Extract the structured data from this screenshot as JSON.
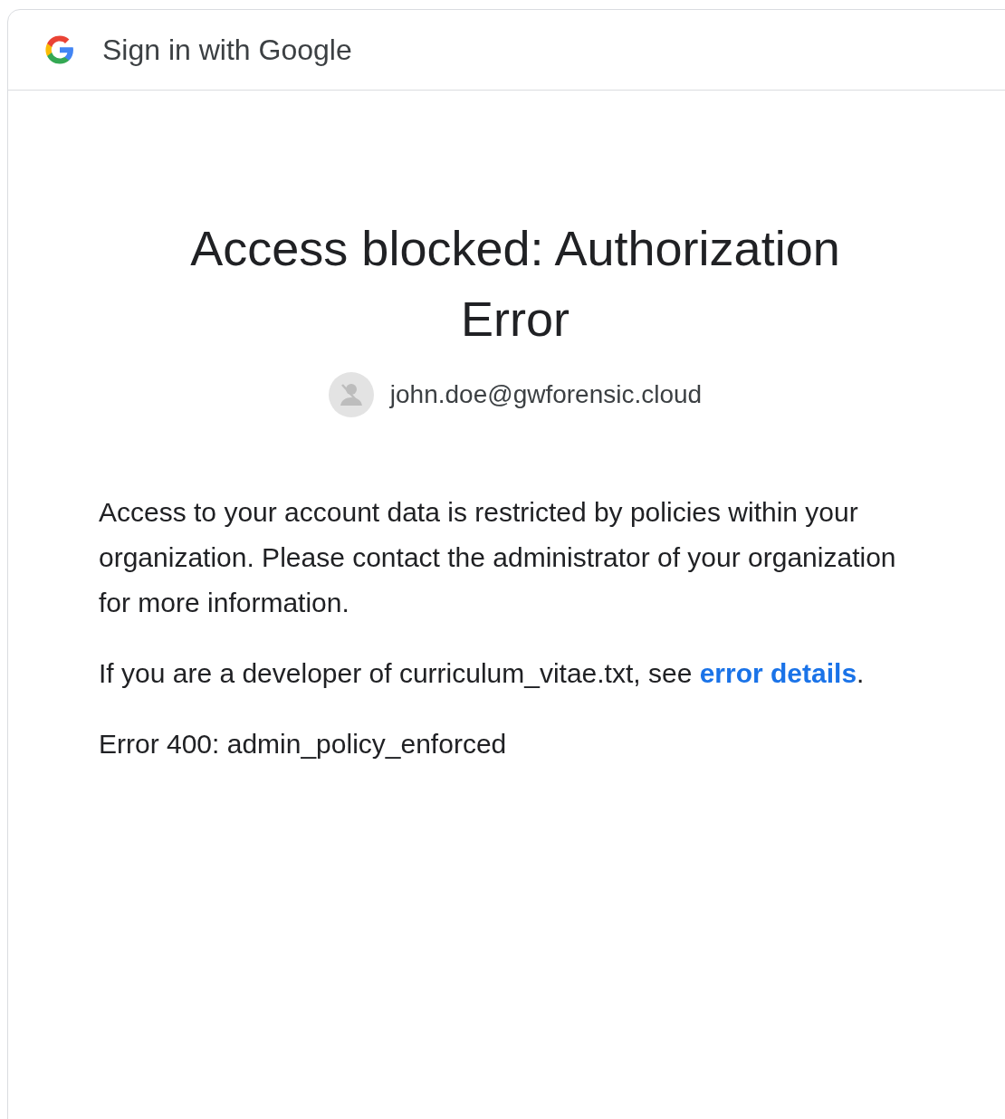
{
  "header": {
    "title": "Sign in with Google"
  },
  "heading": "Access blocked: Authorization Error",
  "account": {
    "email": "john.doe@gwforensic.cloud"
  },
  "paragraphs": [
    {
      "kind": "text",
      "text": "Access to your account data is restricted by policies within your organization. Please contact the administrator of your organization for more information."
    },
    {
      "kind": "link",
      "text": "If you are a developer of curriculum_vitae.txt, see",
      "link": "error details",
      "after": "."
    },
    {
      "kind": "text",
      "text": "Error 400: admin_policy_enforced"
    }
  ]
}
